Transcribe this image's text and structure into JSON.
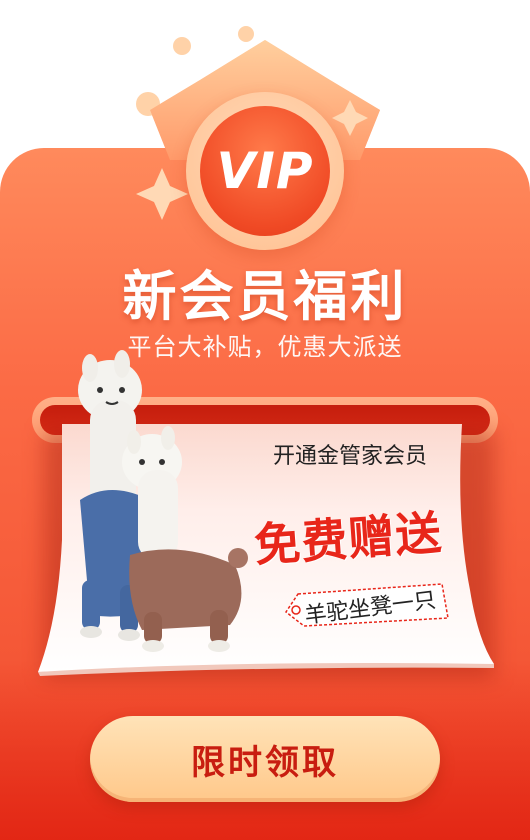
{
  "badge": {
    "label": "VIP"
  },
  "title": "新会员福利",
  "subtitle": "平台大补贴，优惠大派送",
  "promo": {
    "heading": "开通金管家会员",
    "main": "免费赠送",
    "tag_text": "羊驼坐凳一只"
  },
  "cta": {
    "label": "限时领取"
  },
  "colors": {
    "primary": "#f04a2c",
    "accent": "#e8261a",
    "button": "#ffd3a0"
  }
}
